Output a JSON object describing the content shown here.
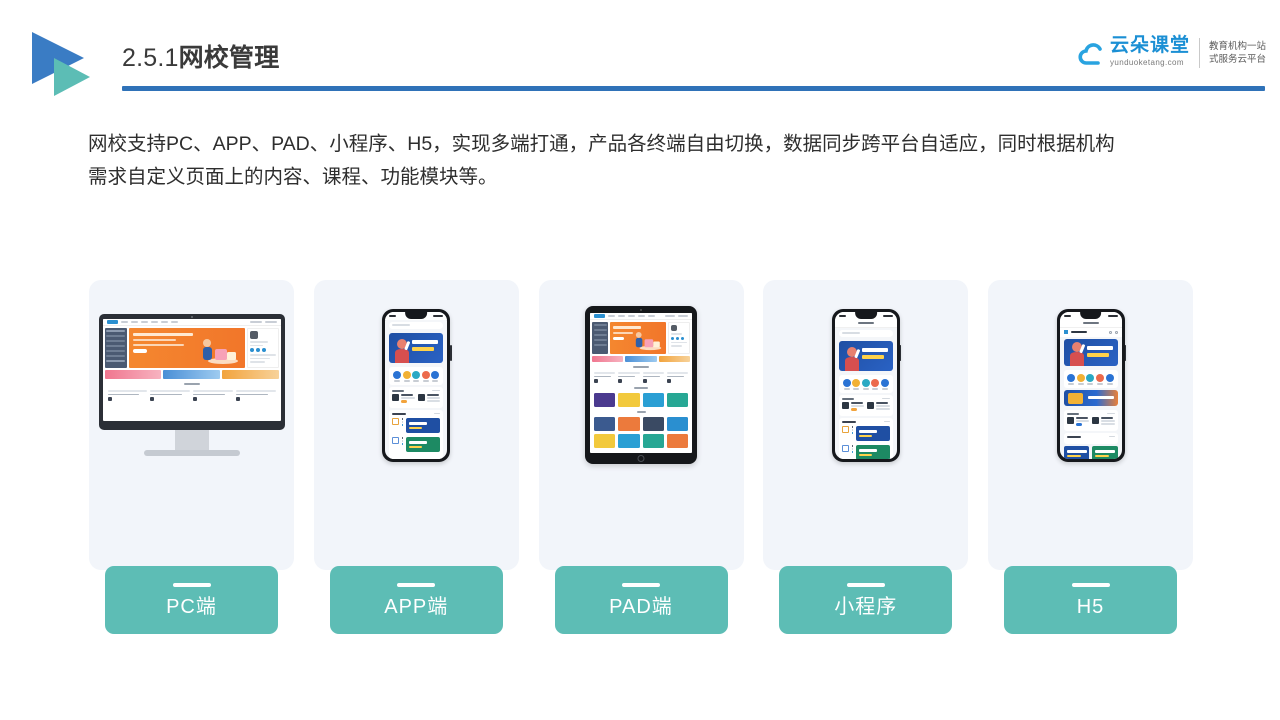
{
  "header": {
    "title_number": "2.5.1",
    "title_text": "网校管理",
    "rule_color": "#2f72b8",
    "logo_blue": "#3a7cc4",
    "logo_teal": "#5cbdb5"
  },
  "brand": {
    "name_cn": "云朵课堂",
    "name_en": "yunduoketang.com",
    "tagline_line1": "教育机构一站",
    "tagline_line2": "式服务云平台",
    "cloud_icon": "cloud-icon",
    "color": "#1b8fd4"
  },
  "body": {
    "line1": "网校支持PC、APP、PAD、小程序、H5，实现多端打通，产品各终端自由切换，数据同步跨平台自适应，同时根据机构",
    "line2": "需求自定义页面上的内容、课程、功能模块等。"
  },
  "cards": {
    "label_bg": "#5dbdb5",
    "card_bg": "#f2f5fa",
    "items": [
      {
        "label": "PC端",
        "device": "desktop-monitor"
      },
      {
        "label": "APP端",
        "device": "smartphone"
      },
      {
        "label": "PAD端",
        "device": "tablet"
      },
      {
        "label": "小程序",
        "device": "smartphone"
      },
      {
        "label": "H5",
        "device": "smartphone"
      }
    ]
  }
}
